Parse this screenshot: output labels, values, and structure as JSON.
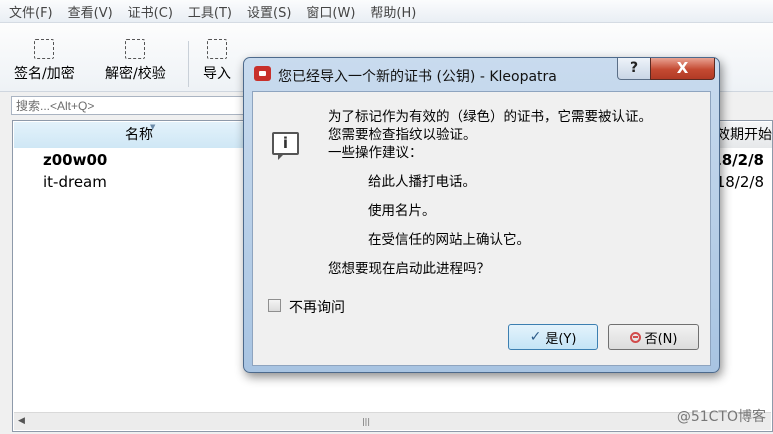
{
  "menubar": [
    "文件(F)",
    "查看(V)",
    "证书(C)",
    "工具(T)",
    "设置(S)",
    "窗口(W)",
    "帮助(H)"
  ],
  "toolbar": {
    "sign_encrypt": "签名/加密",
    "decrypt_verify": "解密/校验",
    "import": "导入"
  },
  "search": {
    "placeholder": "搜索...<Alt+Q>"
  },
  "list": {
    "col_name": "名称",
    "col_valid_from": "效期开始",
    "rows": [
      {
        "name": "z00w00",
        "date": "18/2/8"
      },
      {
        "name": "it-dream",
        "date": "18/2/8"
      }
    ],
    "scroll_thumb": "|||"
  },
  "dialog": {
    "title": "您已经导入一个新的证书 (公钥) - Kleopatra",
    "help": "?",
    "close": "X",
    "line1": "为了标记作为有效的（绿色）的证书，它需要被认证。",
    "line2": "您需要检查指纹以验证。",
    "line3": "一些操作建议：",
    "sug1": "给此人播打电话。",
    "sug2": "使用名片。",
    "sug3": "在受信任的网站上确认它。",
    "question": "您想要现在启动此进程吗？",
    "dont_ask": "不再询问",
    "yes": "是(Y)",
    "no": "否(N)"
  },
  "watermark": "@51CTO博客"
}
